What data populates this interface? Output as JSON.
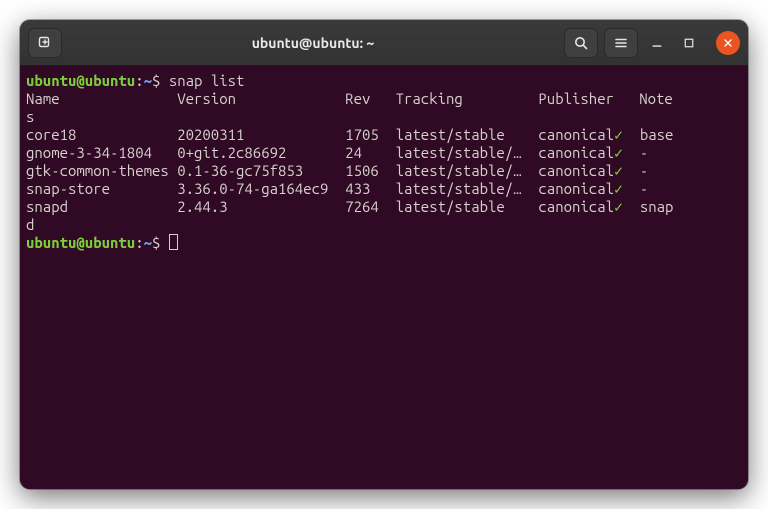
{
  "window": {
    "title": "ubuntu@ubuntu: ~"
  },
  "prompt": {
    "user_host": "ubuntu@ubuntu",
    "colon": ":",
    "path": "~",
    "dollar": "$ "
  },
  "command": "snap list",
  "headers": {
    "name": "Name",
    "version": "Version",
    "rev": "Rev",
    "tracking": "Tracking",
    "publisher": "Publisher",
    "notes": "Notes"
  },
  "headers_wrap": "s",
  "rows": [
    {
      "name": "core18",
      "version": "20200311",
      "rev": "1705",
      "tracking": "latest/stable",
      "publisher": "canonical",
      "verified": true,
      "notes": "base"
    },
    {
      "name": "gnome-3-34-1804",
      "version": "0+git.2c86692",
      "rev": "24",
      "tracking": "latest/stable/…",
      "publisher": "canonical",
      "verified": true,
      "notes": "-"
    },
    {
      "name": "gtk-common-themes",
      "version": "0.1-36-gc75f853",
      "rev": "1506",
      "tracking": "latest/stable/…",
      "publisher": "canonical",
      "verified": true,
      "notes": "-"
    },
    {
      "name": "snap-store",
      "version": "3.36.0-74-ga164ec9",
      "rev": "433",
      "tracking": "latest/stable/…",
      "publisher": "canonical",
      "verified": true,
      "notes": "-"
    },
    {
      "name": "snapd",
      "version": "2.44.3",
      "rev": "7264",
      "tracking": "latest/stable",
      "publisher": "canonical",
      "verified": true,
      "notes": "snapd"
    }
  ],
  "last_wrap": "d",
  "columns": {
    "name": 18,
    "version": 20,
    "rev": 6,
    "tracking": 17,
    "publisher": 9,
    "notes": 5
  }
}
